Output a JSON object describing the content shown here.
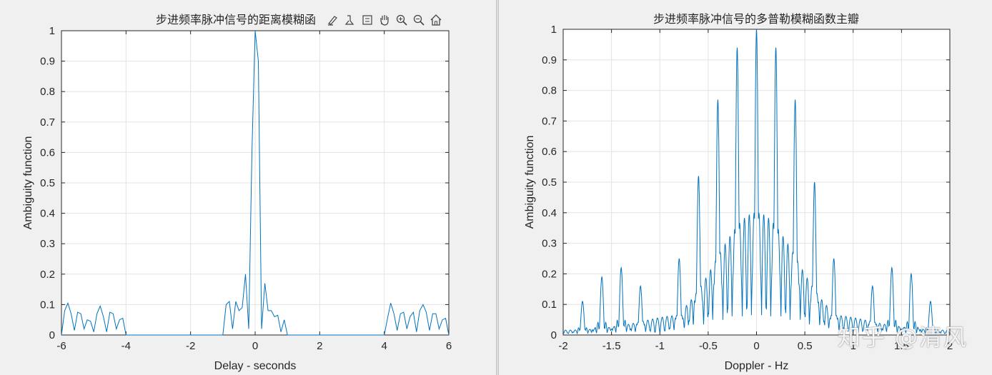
{
  "chart_data": [
    {
      "type": "line",
      "title": "步进频率脉冲信号的距离模糊函",
      "xlabel": "Delay - seconds",
      "ylabel": "Ambiguity function",
      "xlim": [
        -6,
        6
      ],
      "ylim": [
        0,
        1
      ],
      "xticks": [
        "-6",
        "-4",
        "-2",
        "0",
        "2",
        "4",
        "6"
      ],
      "yticks": [
        "0",
        "0.1",
        "0.2",
        "0.3",
        "0.4",
        "0.5",
        "0.6",
        "0.7",
        "0.8",
        "0.9",
        "1"
      ],
      "grid": true,
      "color": "#0072BD",
      "x": [
        -6.0,
        -5.9,
        -5.8,
        -5.7,
        -5.6,
        -5.5,
        -5.4,
        -5.3,
        -5.2,
        -5.1,
        -5.0,
        -4.9,
        -4.8,
        -4.7,
        -4.6,
        -4.5,
        -4.4,
        -4.3,
        -4.2,
        -4.1,
        -4.0,
        -1.0,
        -0.9,
        -0.8,
        -0.7,
        -0.6,
        -0.5,
        -0.4,
        -0.3,
        -0.2,
        -0.1,
        0.0,
        0.1,
        0.2,
        0.3,
        0.4,
        0.5,
        0.6,
        0.7,
        0.8,
        0.9,
        1.0,
        4.0,
        4.1,
        4.2,
        4.3,
        4.4,
        4.5,
        4.6,
        4.7,
        4.8,
        4.9,
        5.0,
        5.1,
        5.2,
        5.3,
        5.4,
        5.5,
        5.6,
        5.7,
        5.8,
        5.9,
        6.0
      ],
      "y": [
        0.0,
        0.08,
        0.105,
        0.07,
        0.015,
        0.075,
        0.07,
        0.02,
        0.05,
        0.045,
        0.01,
        0.07,
        0.095,
        0.06,
        0.01,
        0.075,
        0.07,
        0.02,
        0.05,
        0.055,
        0.0,
        0.0,
        0.1,
        0.11,
        0.02,
        0.11,
        0.08,
        0.09,
        0.2,
        0.02,
        0.6,
        1.0,
        0.9,
        0.02,
        0.17,
        0.08,
        0.08,
        0.06,
        0.065,
        0.01,
        0.05,
        0.0,
        0.0,
        0.055,
        0.105,
        0.07,
        0.015,
        0.07,
        0.075,
        0.02,
        0.06,
        0.075,
        0.01,
        0.08,
        0.1,
        0.075,
        0.015,
        0.07,
        0.07,
        0.02,
        0.05,
        0.055,
        0.0
      ]
    },
    {
      "type": "line",
      "title": "步进频率脉冲信号的多普勒模糊函数主瓣",
      "xlabel": "Doppler - Hz",
      "ylabel": "Ambiguity function",
      "xlim": [
        -2,
        2
      ],
      "ylim": [
        0,
        1
      ],
      "xticks": [
        "-2",
        "-1.5",
        "-1",
        "-0.5",
        "0",
        "0.5",
        "1",
        "1.5",
        "2"
      ],
      "yticks": [
        "0",
        "0.1",
        "0.2",
        "0.3",
        "0.4",
        "0.5",
        "0.6",
        "0.7",
        "0.8",
        "0.9",
        "1"
      ],
      "grid": true,
      "color": "#0072BD",
      "lobes": [
        {
          "center": -1.8,
          "peak": 0.11
        },
        {
          "center": -1.6,
          "peak": 0.19
        },
        {
          "center": -1.4,
          "peak": 0.22
        },
        {
          "center": -1.2,
          "peak": 0.16
        },
        {
          "center": -0.8,
          "peak": 0.25
        },
        {
          "center": -0.6,
          "peak": 0.52
        },
        {
          "center": -0.4,
          "peak": 0.77
        },
        {
          "center": -0.2,
          "peak": 0.94
        },
        {
          "center": 0.0,
          "peak": 1.0
        },
        {
          "center": 0.2,
          "peak": 0.94
        },
        {
          "center": 0.4,
          "peak": 0.77
        },
        {
          "center": 0.6,
          "peak": 0.5
        },
        {
          "center": 0.8,
          "peak": 0.25
        },
        {
          "center": 1.2,
          "peak": 0.16
        },
        {
          "center": 1.4,
          "peak": 0.22
        },
        {
          "center": 1.6,
          "peak": 0.2
        },
        {
          "center": 1.8,
          "peak": 0.11
        }
      ],
      "sidelobe_level": {
        "central": 0.28,
        "outer": 0.05
      }
    }
  ],
  "watermark": "知乎 @清风",
  "toolbar": [
    "brush-icon",
    "insert-colorbar-icon",
    "pan-icon",
    "zoom-in-icon",
    "zoom-out-icon",
    "home-icon"
  ]
}
